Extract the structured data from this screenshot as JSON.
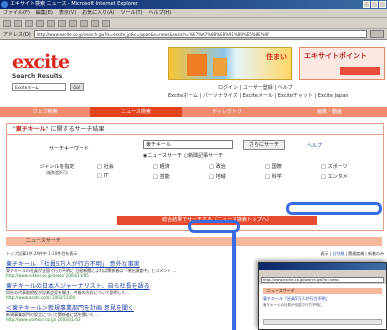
{
  "window": {
    "title": "エキサイト検索 ニュース - Microsoft Internet Explorer",
    "menu": [
      "ファイル(F)",
      "編集(E)",
      "表示(V)",
      "お気に入り(A)",
      "ツール(T)",
      "ヘルプ(H)"
    ],
    "address_label": "アドレス(D)",
    "address_value": "http://www.excite.co.jp/search.gw?lk=excite_jp&c=japan&s=news&search=%E7%A7%8B%E8%91%89%E5%8E%9F"
  },
  "site": {
    "logo_text": "excite",
    "logo_sub": "Search Results",
    "search_small_value": "Exciteホーム",
    "go_label": "Go!",
    "banner1_text": "住まい",
    "banner2_text": "エキサイトポイント",
    "toplinks": "ログイン | ユーザー登録 | ヘルプ",
    "toplinks2": "Exciteホーム | パーソナライズ | Exciteメール | Exciteチャット | Excite Japan"
  },
  "nav_tabs": [
    "ウェブ検索",
    "ニュース検索",
    "ディレクトリ",
    "画像・動画"
  ],
  "search_panel": {
    "heading_prefix": "\"",
    "heading_keyword": "東チキール",
    "heading_suffix": "\" に関するサーチ結果",
    "query_label": "サーチキーワード",
    "query_value": "東チキール",
    "submit_label": "さらにサーチ",
    "help_label": "ヘルプ",
    "radio_text": "◉ニュースサーチ ○新聞記事サーチ",
    "side_label": "ジャンルを指定",
    "side_sub": "（複数選択可）",
    "categories": [
      "社会",
      "経済",
      "政治",
      "国際",
      "スポーツ",
      "IT",
      "芸能",
      "地域",
      "科学",
      "エンタメ"
    ],
    "bar_text": "総合結果でサーチする（ニュース検索トップへ）"
  },
  "news": {
    "bar_label": "ニュースサーチ",
    "meta_left": "トップ記事1件 24件中 1-10件目を表示",
    "meta_right_prefix": "表示 | ",
    "meta_right_link": "日付順",
    "meta_right_suffix": " | 関連度順 | 新着のみ",
    "results": [
      {
        "title": "東チキール 「社員5万人が行方不明」 意外な事実",
        "desc": "東チキールの社員が全国で行方不明に 日経新聞によれば関係者は「現在調査中」とコメント ...",
        "url": "http://www.nikkei.co.jp/news/ 2003/11/05"
      },
      {
        "title": "東チキールの日本人ジャーナリスト、自ら社長を語る",
        "desc": "同社の代表取締役が記者会見を開き、今後の方針について説明した ...",
        "url": "http://www.asahi.com/ 2003/11/04"
      },
      {
        "title": "＜東チキール＞新規事業部門を計画 意見を聞く",
        "desc": "新規事業部門の設立について関係者に話を聞いた ...",
        "url": "http://www.yomiuri.co.jp/ 2003/11/03"
      }
    ]
  },
  "popup": {
    "address": "http://www.excite.co.jp/search.gw?lk=news",
    "news_label": "ニュースサーチ",
    "row1": "東チキール「社員5万人が行方不明」",
    "row2": "東チキールの社員が全国で行方不明に"
  }
}
